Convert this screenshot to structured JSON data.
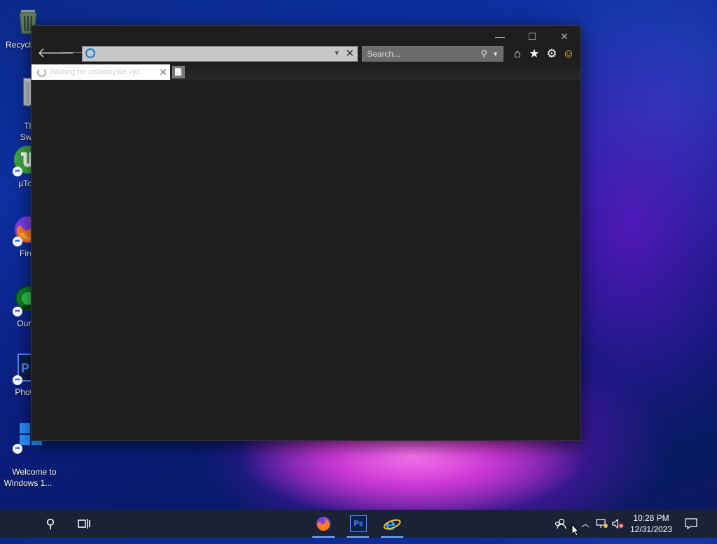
{
  "desktop": {
    "icons": [
      {
        "label": "Recycl",
        "icon": "recycle-bin-icon"
      },
      {
        "label": "Ther\nSwit",
        "icon": "file-icon"
      },
      {
        "label": "µTorr",
        "icon": "utorrent-icon"
      },
      {
        "label": "Firef",
        "icon": "firefox-icon"
      },
      {
        "label": "Our B",
        "icon": "game-icon"
      },
      {
        "label": "Photos",
        "icon": "photoshop-icon"
      },
      {
        "label": "Welcome to\nWindows 1...",
        "icon": "windows-logo-icon"
      }
    ]
  },
  "browser": {
    "address_value": "",
    "search_placeholder": "Search...",
    "tab_title": "Waiting for collabsyste.xyz",
    "colors": {
      "frame": "#1e1e1e",
      "address_bg": "#c7c7c7",
      "search_bg": "#6b6b6b"
    }
  },
  "taskbar": {
    "apps": [
      "firefox-icon",
      "photoshop-icon",
      "internet-explorer-icon"
    ],
    "photoshop_label": "Ps",
    "time": "10:28 PM",
    "date": "12/31/2023"
  }
}
